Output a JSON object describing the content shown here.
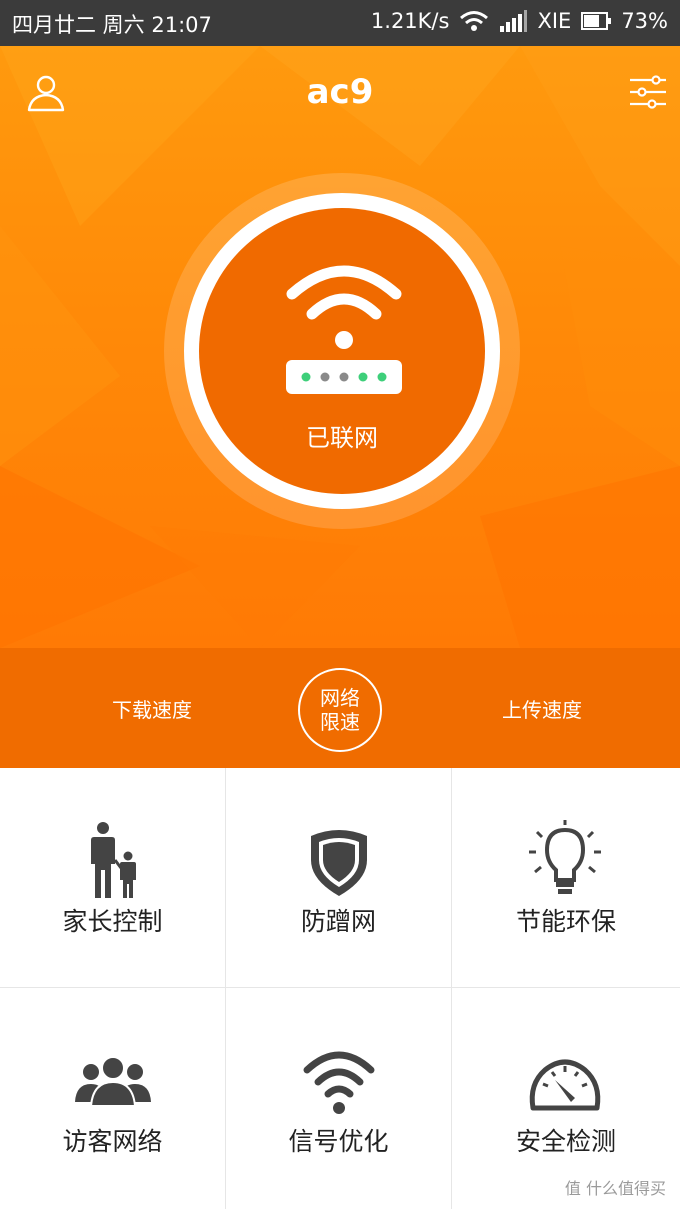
{
  "status_bar": {
    "date_time": "四月廿二 周六 21:07",
    "net_speed": "1.21K/s",
    "carrier": "XIE",
    "battery": "73%"
  },
  "header": {
    "title": "ac9"
  },
  "router": {
    "status": "已联网"
  },
  "speed": {
    "download_label": "下载速度",
    "upload_label": "上传速度",
    "limit_line1": "网络",
    "limit_line2": "限速"
  },
  "features": [
    {
      "label": "家长控制",
      "icon": "parent-child-icon"
    },
    {
      "label": "防蹭网",
      "icon": "shield-icon"
    },
    {
      "label": "节能环保",
      "icon": "lightbulb-icon"
    },
    {
      "label": "访客网络",
      "icon": "guests-icon"
    },
    {
      "label": "信号优化",
      "icon": "wifi-signal-icon"
    },
    {
      "label": "安全检测",
      "icon": "speedometer-icon"
    }
  ],
  "watermark": "值 什么值得买",
  "colors": {
    "brand_orange": "#ff8a08",
    "deep_orange": "#f06a00",
    "led_green": "#3ecf7a"
  }
}
